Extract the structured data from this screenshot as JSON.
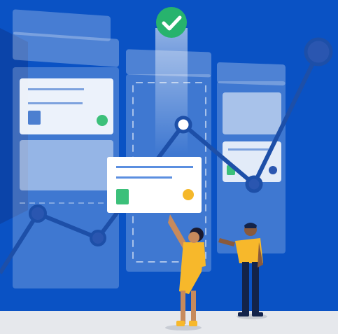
{
  "scene": {
    "colors": {
      "background": "#0a52c4",
      "panel": "#ffffff",
      "chart_line": "#1d4fa8",
      "chart_node": "#2a56b0",
      "check_badge": "#27b36d",
      "card_green": "#3cc07a",
      "card_yellow": "#f5b82a",
      "card_blue": "#4c7fd0",
      "floor": "#e6e8ec",
      "person_dress": "#f7b82b",
      "person_shirt": "#f7b82b",
      "person_pants": "#13234a"
    },
    "icons": [
      "check-icon"
    ],
    "figures": [
      "person-woman",
      "person-man"
    ]
  }
}
